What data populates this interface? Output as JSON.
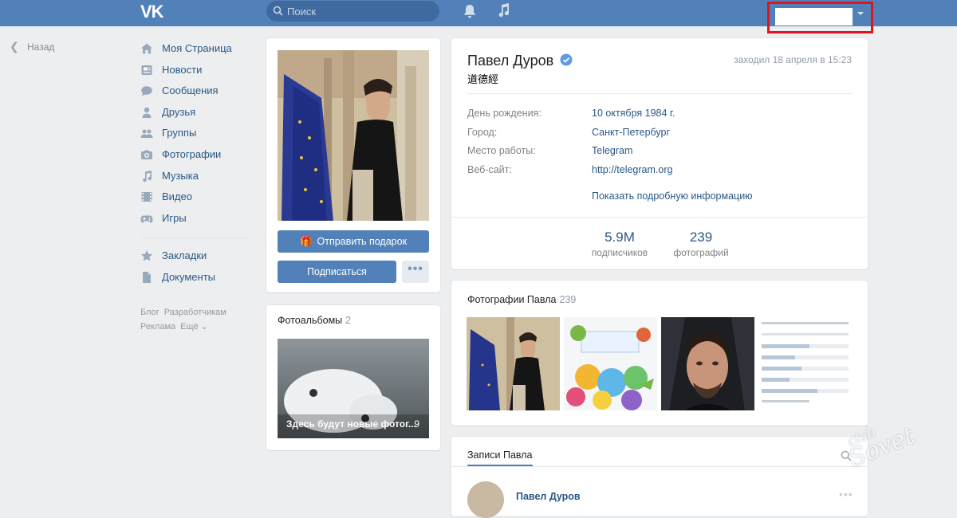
{
  "topbar": {
    "logo": "VK",
    "search_placeholder": "Поиск"
  },
  "sidebar": {
    "back_label": "Назад",
    "items": [
      {
        "label": "Моя Страница",
        "icon": "home-icon"
      },
      {
        "label": "Новости",
        "icon": "news-icon"
      },
      {
        "label": "Сообщения",
        "icon": "messages-icon"
      },
      {
        "label": "Друзья",
        "icon": "friends-icon"
      },
      {
        "label": "Группы",
        "icon": "groups-icon"
      },
      {
        "label": "Фотографии",
        "icon": "camera-icon"
      },
      {
        "label": "Музыка",
        "icon": "music-icon"
      },
      {
        "label": "Видео",
        "icon": "video-icon"
      },
      {
        "label": "Игры",
        "icon": "games-icon"
      }
    ],
    "items2": [
      {
        "label": "Закладки",
        "icon": "star-icon"
      },
      {
        "label": "Документы",
        "icon": "document-icon"
      }
    ],
    "footer": [
      "Блог",
      "Разработчикам",
      "Реклама",
      "Ещё ⌄"
    ]
  },
  "profile": {
    "gift_button": "Отправить подарок",
    "subscribe_button": "Подписаться",
    "more_button": "•••",
    "albums_title": "Фотоальбомы",
    "albums_count": "2",
    "album_caption": "Здесь будут новые фотог...",
    "album_photo_count": "9"
  },
  "info": {
    "name": "Павел Дуров",
    "status": "道德經",
    "last_seen": "заходил 18 апреля в 15:23",
    "rows": [
      {
        "key": "День рождения:",
        "value": "10 октября 1984 г."
      },
      {
        "key": "Город:",
        "value": "Санкт-Петербург"
      },
      {
        "key": "Место работы:",
        "value": "Telegram"
      },
      {
        "key": "Веб-сайт:",
        "value": "http://telegram.org"
      }
    ],
    "show_more": "Показать подробную информацию",
    "stats": [
      {
        "num": "5.9M",
        "label": "подписчиков"
      },
      {
        "num": "239",
        "label": "фотографий"
      }
    ]
  },
  "photos": {
    "title": "Фотографии Павла",
    "count": "239"
  },
  "posts": {
    "tab": "Записи Павла",
    "author": "Павел Дуров"
  },
  "colors": {
    "header": "#5181b8",
    "link": "#2a5885",
    "background": "#edeef0",
    "highlight_border": "#e0141e"
  }
}
